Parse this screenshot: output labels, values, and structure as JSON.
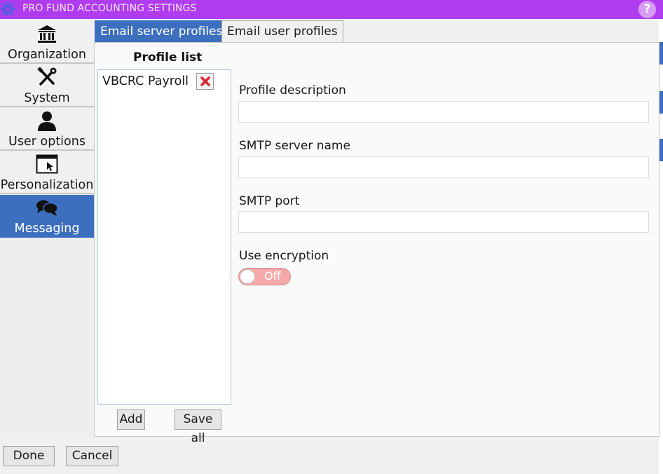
{
  "window": {
    "title": "PRO FUND ACCOUNTING SETTINGS",
    "help_label": "?"
  },
  "sidebar": {
    "items": [
      {
        "label": "Organization",
        "icon": "bank-icon"
      },
      {
        "label": "System",
        "icon": "tools-icon"
      },
      {
        "label": "User options",
        "icon": "user-icon"
      },
      {
        "label": "Personalization",
        "icon": "window-cursor-icon"
      },
      {
        "label": "Messaging",
        "icon": "chat-bubbles-icon",
        "active": true
      }
    ]
  },
  "tabs": [
    {
      "label": "Email server profiles",
      "active": true
    },
    {
      "label": "Email user profiles",
      "active": false
    }
  ],
  "profiles": {
    "title": "Profile list",
    "items": [
      {
        "name": "VBCRC Payroll"
      }
    ],
    "add_label": "Add",
    "save_all_label": "Save all"
  },
  "form": {
    "description_label": "Profile description",
    "description_value": "",
    "smtp_server_label": "SMTP server name",
    "smtp_server_value": "",
    "smtp_port_label": "SMTP port",
    "smtp_port_value": "",
    "encryption_label": "Use encryption",
    "encryption_state": "Off"
  },
  "footer": {
    "done_label": "Done",
    "cancel_label": "Cancel"
  },
  "colors": {
    "titlebar": "#b03cf0",
    "accent": "#3d6fbf",
    "toggle_off": "#f6a9ab",
    "delete": "#d9262c"
  }
}
